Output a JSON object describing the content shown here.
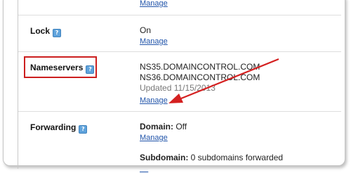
{
  "top": {
    "manage_label": "Manage"
  },
  "lock": {
    "label": "Lock",
    "value": "On",
    "manage_label": "Manage"
  },
  "nameservers": {
    "label": "Nameservers",
    "ns1": "NS35.DOMAINCONTROL.COM",
    "ns2": "NS36.DOMAINCONTROL.COM",
    "updated": "Updated 11/15/2013",
    "manage_label": "Manage"
  },
  "forwarding": {
    "label": "Forwarding",
    "domain_label": "Domain:",
    "domain_value": "Off",
    "manage_label": "Manage",
    "subdomain_label": "Subdomain:",
    "subdomain_value": "0 subdomains forwarded"
  },
  "help_glyph": "?",
  "annotation": {
    "highlight_color": "#cc1f1f",
    "arrow_color": "#d42020"
  }
}
